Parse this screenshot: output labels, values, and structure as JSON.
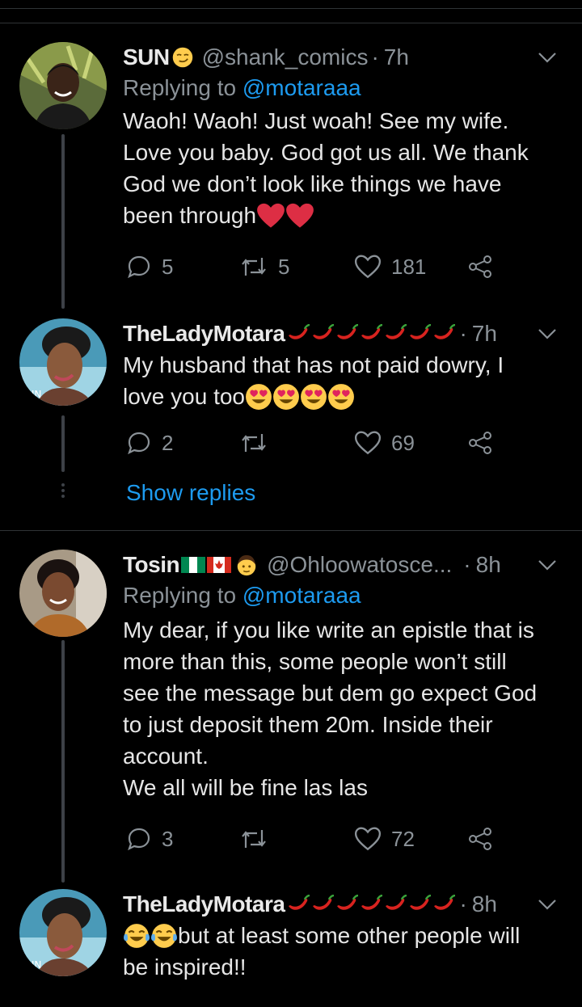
{
  "tweets": [
    {
      "name": "SUN",
      "handle": "@shank_comics",
      "time": "7h",
      "replying_prefix": "Replying to",
      "replying_to": "@motaraaa",
      "text_lines": [
        "Waoh! Waoh! Just woah! See my wife.",
        "Love you baby. God got us all. We thank",
        "God we don’t look like things we have",
        "been through"
      ],
      "replies": "5",
      "retweets": "5",
      "likes": "181"
    },
    {
      "name": "TheLadyMotara",
      "time": "7h",
      "text_lines": [
        "My husband that has not paid dowry, I",
        "love you too"
      ],
      "replies": "2",
      "retweets": "",
      "likes": "69"
    },
    {
      "name": "Tosin",
      "handle": "@Ohloowatosce...",
      "time": "8h",
      "replying_prefix": "Replying to",
      "replying_to": "@motaraaa",
      "text_lines": [
        "My dear, if you like write an epistle that is",
        "more than this, some people won’t still",
        "see the message but dem go expect God",
        "to just deposit them 20m. Inside their",
        "account.",
        "We all will be fine las las"
      ],
      "replies": "3",
      "retweets": "",
      "likes": "72"
    },
    {
      "name": "TheLadyMotara",
      "time": "8h",
      "text_lines": [
        "but at least some other people will",
        "be inspired!!"
      ]
    }
  ],
  "show_replies": "Show replies",
  "colors": {
    "background": "#000000",
    "accent": "#1d9bf0",
    "muted": "#8b9298",
    "text": "#e6e6e6"
  },
  "icons": [
    "reply-icon",
    "retweet-icon",
    "like-icon",
    "share-icon",
    "chevron-down-icon",
    "heart-emoji",
    "chili-emoji",
    "heart-eyes-emoji",
    "smirk-emoji",
    "tears-of-joy-emoji",
    "nigeria-flag",
    "canada-flag",
    "man-emoji"
  ]
}
